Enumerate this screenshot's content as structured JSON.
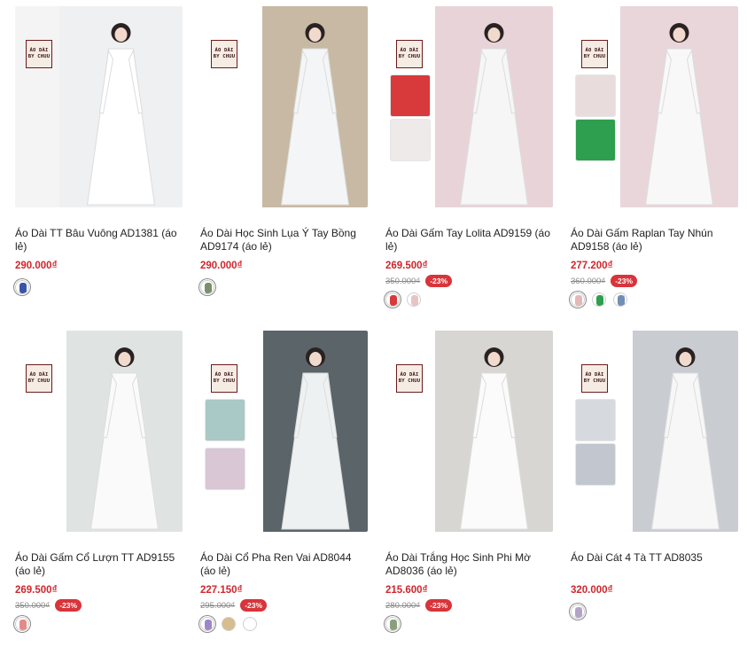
{
  "logo_lines": [
    "ÁO DÀI",
    "BY CHUU"
  ],
  "products": [
    {
      "title": "Áo Dài TT Bâu Vuông AD1381 (áo lẻ)",
      "price": "290.000₫",
      "old_price": "",
      "discount": "",
      "bg": "#f4f4f4",
      "photo": "#eef0f2",
      "dress": "#ffffff",
      "insets": [],
      "swatches": [
        {
          "type": "image",
          "color": "#3a55a8"
        }
      ]
    },
    {
      "title": "Áo Dài Học Sinh Lụa Ý Tay Bồng AD9174 (áo lẻ)",
      "price": "290.000₫",
      "old_price": "",
      "discount": "",
      "bg": "#ffffff",
      "photo": "#c7b9a3",
      "dress": "#f4f5f7",
      "insets": [],
      "swatches": [
        {
          "type": "image",
          "color": "#7a8f6a"
        }
      ]
    },
    {
      "title": "Áo Dài Gấm Tay Lolita AD9159 (áo lẻ)",
      "price": "269.500₫",
      "old_price": "350.000₫",
      "discount": "-23%",
      "bg": "#ffffff",
      "photo": "#e8d4d8",
      "dress": "#f7f6f6",
      "insets": [
        "#d8393a",
        "#efeaea"
      ],
      "swatches": [
        {
          "type": "image",
          "color": "#d8393a"
        },
        {
          "type": "image",
          "color": "#e7c4c4"
        }
      ]
    },
    {
      "title": "Áo Dài Gấm Raplan Tay Nhún AD9158 (áo lẻ)",
      "price": "277.200₫",
      "old_price": "360.000₫",
      "discount": "-23%",
      "bg": "#ffffff",
      "photo": "#e9d6da",
      "dress": "#f9f8f8",
      "insets": [
        "#e8dcdc",
        "#2e9e4f"
      ],
      "swatches": [
        {
          "type": "image",
          "color": "#e4b8b8"
        },
        {
          "type": "image",
          "color": "#2e9e4f"
        },
        {
          "type": "image",
          "color": "#6f8fb5"
        }
      ]
    },
    {
      "title": "Áo Dài Gấm Cổ Lượn TT AD9155 (áo lẻ)",
      "price": "269.500₫",
      "old_price": "350.000₫",
      "discount": "-23%",
      "bg": "#ffffff",
      "photo": "#dfe4e3",
      "dress": "#fafafa",
      "insets": [],
      "swatches": [
        {
          "type": "image",
          "color": "#e38a8a"
        }
      ]
    },
    {
      "title": "Áo Dài Cổ Pha Ren Vai AD8044 (áo lẻ)",
      "price": "227.150₫",
      "old_price": "295.000₫",
      "discount": "-23%",
      "bg": "#ffffff",
      "photo": "#5b6468",
      "dress": "#eef1f2",
      "insets": [
        "#a9c9c6",
        "#d9c7d5"
      ],
      "swatches": [
        {
          "type": "image",
          "color": "#9d87c6"
        },
        {
          "type": "solid",
          "color": "#d7bd8d"
        },
        {
          "type": "solid",
          "color": "#ffffff"
        }
      ]
    },
    {
      "title": "Áo Dài Trắng Học Sinh Phi Mờ AD8036 (áo lẻ)",
      "price": "215.600₫",
      "old_price": "280.000₫",
      "discount": "-23%",
      "bg": "#ffffff",
      "photo": "#d7d6d2",
      "dress": "#fbfbfb",
      "insets": [],
      "swatches": [
        {
          "type": "image",
          "color": "#8aa07c"
        }
      ]
    },
    {
      "title": "Áo Dài Cát 4 Tà TT AD8035",
      "price": "320.000₫",
      "old_price": "",
      "discount": "",
      "bg": "#ffffff",
      "photo": "#c9ccd1",
      "dress": "#f7f7f8",
      "insets": [
        "#d6d9de",
        "#c2c7cf"
      ],
      "swatches": [
        {
          "type": "image",
          "color": "#b4a3c7"
        }
      ]
    }
  ]
}
